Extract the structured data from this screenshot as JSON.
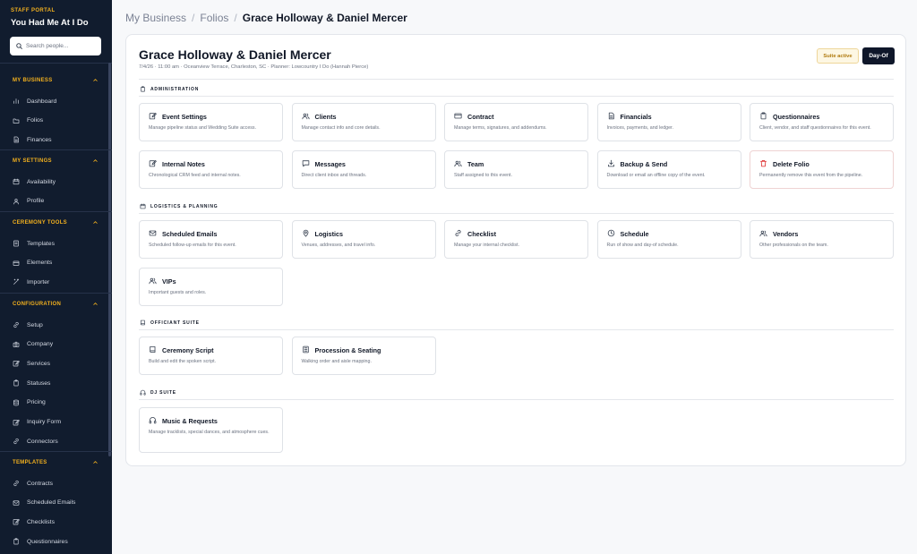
{
  "sidebar": {
    "kicker": "STAFF PORTAL",
    "brand": "You Had Me At I Do",
    "search_placeholder": "Search people...",
    "sections": [
      {
        "title": "MY BUSINESS",
        "items": [
          {
            "label": "Dashboard",
            "icon": "bar-chart-icon"
          },
          {
            "label": "Folios",
            "icon": "folder-icon"
          },
          {
            "label": "Finances",
            "icon": "document-icon"
          }
        ]
      },
      {
        "title": "MY SETTINGS",
        "items": [
          {
            "label": "Availability",
            "icon": "calendar-icon"
          },
          {
            "label": "Profile",
            "icon": "user-icon"
          }
        ]
      },
      {
        "title": "CEREMONY TOOLS",
        "items": [
          {
            "label": "Templates",
            "icon": "template-icon"
          },
          {
            "label": "Elements",
            "icon": "layers-icon"
          },
          {
            "label": "Importer",
            "icon": "wand-icon"
          }
        ]
      },
      {
        "title": "CONFIGURATION",
        "items": [
          {
            "label": "Setup",
            "icon": "link-icon"
          },
          {
            "label": "Company",
            "icon": "camera-icon"
          },
          {
            "label": "Services",
            "icon": "edit-icon"
          },
          {
            "label": "Statuses",
            "icon": "clipboard-icon"
          },
          {
            "label": "Pricing",
            "icon": "stack-icon"
          },
          {
            "label": "Inquiry Form",
            "icon": "edit-icon"
          },
          {
            "label": "Connectors",
            "icon": "link-icon"
          }
        ]
      },
      {
        "title": "TEMPLATES",
        "items": [
          {
            "label": "Contracts",
            "icon": "link-icon"
          },
          {
            "label": "Scheduled Emails",
            "icon": "mail-icon"
          },
          {
            "label": "Checklists",
            "icon": "edit-icon"
          },
          {
            "label": "Questionnaires",
            "icon": "clipboard-icon"
          }
        ]
      }
    ]
  },
  "breadcrumb": {
    "items": [
      "My Business",
      "Folios"
    ],
    "separator": "/",
    "current": "Grace Holloway & Daniel Mercer"
  },
  "folio": {
    "title": "Grace Holloway & Daniel Mercer",
    "meta": "7/4/26 · 11:00 am · Oceanview Terrace, Charleston, SC · Planner: Lowcountry I Do (Hannah Pierce)",
    "suite_badge": "Suite active",
    "dayof_label": "Day-Of"
  },
  "groups": [
    {
      "title": "ADMINISTRATION",
      "icon": "clipboard-icon",
      "cards": [
        {
          "title": "Event Settings",
          "desc": "Manage pipeline status and Wedding Suite access.",
          "icon": "edit-icon"
        },
        {
          "title": "Clients",
          "desc": "Manage contact info and core details.",
          "icon": "users-icon"
        },
        {
          "title": "Contract",
          "desc": "Manage terms, signatures, and addendums.",
          "icon": "card-icon"
        },
        {
          "title": "Financials",
          "desc": "Invoices, payments, and ledger.",
          "icon": "document-icon"
        },
        {
          "title": "Questionnaires",
          "desc": "Client, vendor, and staff questionnaires for this event.",
          "icon": "clipboard-icon"
        },
        {
          "title": "Internal Notes",
          "desc": "Chronological CRM feed and internal notes.",
          "icon": "edit-icon"
        },
        {
          "title": "Messages",
          "desc": "Direct client inbox and threads.",
          "icon": "message-icon"
        },
        {
          "title": "Team",
          "desc": "Staff assigned to this event.",
          "icon": "users-icon"
        },
        {
          "title": "Backup & Send",
          "desc": "Download or email an offline copy of the event.",
          "icon": "download-icon"
        },
        {
          "title": "Delete Folio",
          "desc": "Permanently remove this event from the pipeline.",
          "icon": "trash-icon",
          "danger": true
        }
      ]
    },
    {
      "title": "LOGISTICS & PLANNING",
      "icon": "calendar-icon",
      "cards": [
        {
          "title": "Scheduled Emails",
          "desc": "Scheduled follow-up emails for this event.",
          "icon": "mail-icon"
        },
        {
          "title": "Logistics",
          "desc": "Venues, addresses, and travel info.",
          "icon": "pin-icon"
        },
        {
          "title": "Checklist",
          "desc": "Manage your internal checklist.",
          "icon": "link-icon"
        },
        {
          "title": "Schedule",
          "desc": "Run of show and day-of schedule.",
          "icon": "clock-icon"
        },
        {
          "title": "Vendors",
          "desc": "Other professionals on the team.",
          "icon": "users-icon"
        },
        {
          "title": "VIPs",
          "desc": "Important guests and roles.",
          "icon": "users-icon"
        }
      ]
    },
    {
      "title": "OFFICIANT SUITE",
      "icon": "book-icon",
      "cards": [
        {
          "title": "Ceremony Script",
          "desc": "Build and edit the spoken script.",
          "icon": "book-icon"
        },
        {
          "title": "Procession & Seating",
          "desc": "Walking order and aisle mapping.",
          "icon": "list-icon"
        }
      ]
    },
    {
      "title": "DJ SUITE",
      "icon": "headphones-icon",
      "cards": [
        {
          "title": "Music & Requests",
          "desc": "Manage tracklists, special dances, and atmosphere cues.",
          "icon": "headphones-icon"
        }
      ]
    }
  ],
  "colors": {
    "sidebar_bg": "#111c2e",
    "accent": "#f2b01e",
    "danger": "#dc2626",
    "dark_button": "#0f172a",
    "badge_bg": "#fdf7e3"
  }
}
